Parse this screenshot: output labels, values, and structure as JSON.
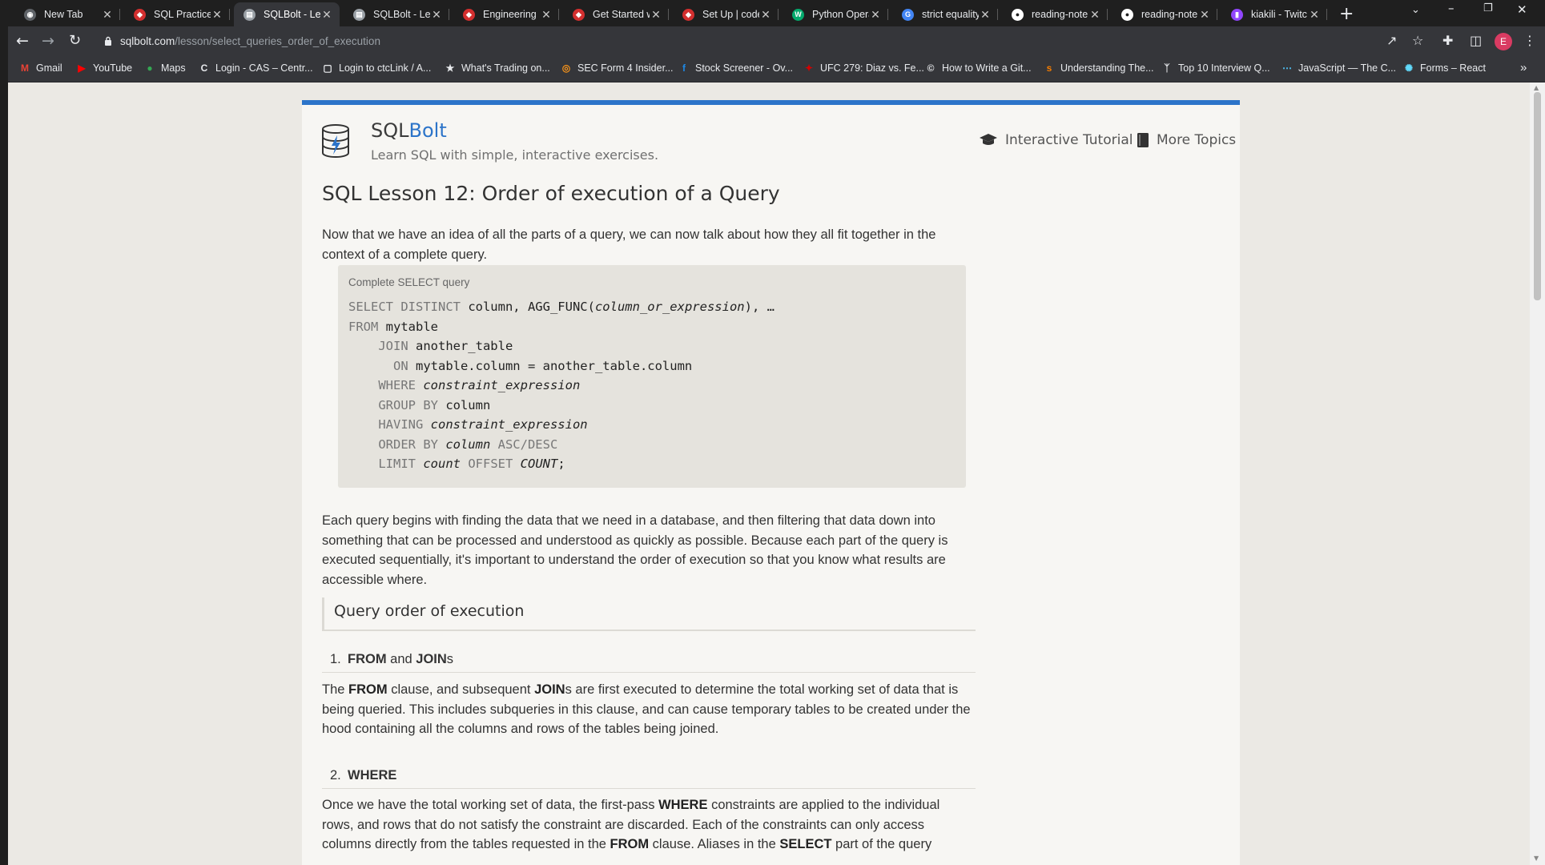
{
  "browser": {
    "tabs": [
      {
        "label": "New Tab",
        "icon": "chrome-icon",
        "color": "#5f6368",
        "active": false
      },
      {
        "label": "SQL Practice |",
        "icon": "shield-icon",
        "color": "#d32f2f",
        "active": false
      },
      {
        "label": "SQLBolt - Lea",
        "icon": "sqlbolt-icon",
        "color": "#9aa0a6",
        "active": true
      },
      {
        "label": "SQLBolt - Lea",
        "icon": "sqlbolt-icon",
        "color": "#9aa0a6",
        "active": false
      },
      {
        "label": "Engineering F",
        "icon": "shield-icon",
        "color": "#d32f2f",
        "active": false
      },
      {
        "label": "Get Started w",
        "icon": "shield-icon",
        "color": "#d32f2f",
        "active": false
      },
      {
        "label": "Set Up | code",
        "icon": "shield-icon",
        "color": "#d32f2f",
        "active": false
      },
      {
        "label": "Python Opera",
        "icon": "w3-icon",
        "color": "#04aa6d",
        "active": false
      },
      {
        "label": "strict equality",
        "icon": "google-icon",
        "color": "#4285f4",
        "active": false
      },
      {
        "label": "reading-note",
        "icon": "github-icon",
        "color": "#ffffff",
        "active": false
      },
      {
        "label": "reading-note",
        "icon": "github-icon",
        "color": "#ffffff",
        "active": false
      },
      {
        "label": "kiakili - Twitc",
        "icon": "twitch-icon",
        "color": "#9146ff",
        "active": false
      }
    ],
    "address": {
      "domain": "sqlbolt.com",
      "path": "/lesson/select_queries_order_of_execution"
    },
    "profile_initial": "E",
    "bookmarks": [
      {
        "label": "Gmail",
        "icon": "gmail-icon",
        "color": "#ea4335"
      },
      {
        "label": "YouTube",
        "icon": "youtube-icon",
        "color": "#ff0000"
      },
      {
        "label": "Maps",
        "icon": "maps-icon",
        "color": "#34a853"
      },
      {
        "label": "Login - CAS – Centr...",
        "icon": "cas-icon",
        "color": "#e8eaed"
      },
      {
        "label": "Login to ctcLink / A...",
        "icon": "ctclink-icon",
        "color": "#e8eaed"
      },
      {
        "label": "What's Trading on...",
        "icon": "star-icon",
        "color": "#e8eaed"
      },
      {
        "label": "SEC Form 4 Insider...",
        "icon": "sec-icon",
        "color": "#f7931a"
      },
      {
        "label": "Stock Screener - Ov...",
        "icon": "finviz-icon",
        "color": "#1e88e5"
      },
      {
        "label": "UFC 279: Diaz vs. Fe...",
        "icon": "ufc-icon",
        "color": "#d50000"
      },
      {
        "label": "How to Write a Git...",
        "icon": "copyright-icon",
        "color": "#e8eaed"
      },
      {
        "label": "Understanding The...",
        "icon": "sp-icon",
        "color": "#f57c00"
      },
      {
        "label": "Top 10 Interview Q...",
        "icon": "deer-icon",
        "color": "#e8eaed"
      },
      {
        "label": "JavaScript — The C...",
        "icon": "dots-icon",
        "color": "#4fc3f7"
      },
      {
        "label": "Forms – React",
        "icon": "react-icon",
        "color": "#61dafb"
      }
    ]
  },
  "site": {
    "brand_prefix": "SQL",
    "brand_suffix": "Bolt",
    "tagline": "Learn SQL with simple, interactive exercises.",
    "nav": {
      "tutorial": "Interactive Tutorial",
      "topics": "More Topics"
    },
    "accent": "#2c74c9"
  },
  "lesson": {
    "title": "SQL Lesson 12: Order of execution of a Query",
    "intro": "Now that we have an idea of all the parts of a query, we can now talk about how they all fit together in the context of a complete query.",
    "code_caption": "Complete SELECT query",
    "code": [
      {
        "kw": "SELECT DISTINCT",
        "text": " column, AGG_FUNC(",
        "it": "column_or_expression",
        "tail": "), …"
      },
      {
        "kw": "FROM",
        "text": " mytable"
      },
      {
        "kw": "    JOIN",
        "text": " another_table"
      },
      {
        "kw": "      ON",
        "text": " mytable.column = another_table.column"
      },
      {
        "kw": "    WHERE",
        "it": " constraint_expression"
      },
      {
        "kw": "    GROUP BY",
        "text": " column"
      },
      {
        "kw": "    HAVING",
        "it": " constraint_expression"
      },
      {
        "kw": "    ORDER BY",
        "it": " column",
        "kw2": " ASC/DESC"
      },
      {
        "kw": "    LIMIT",
        "it2": " count",
        "kw2": " OFFSET",
        "it3": " COUNT",
        "tail": ";"
      }
    ],
    "explanation": "Each query begins with finding the data that we need in a database, and then filtering that data down into something that can be processed and understood as quickly as possible. Because each part of the query is executed sequentially, it's important to understand the order of execution so that you know what results are accessible where.",
    "section_title": "Query order of execution",
    "steps": [
      {
        "num": "1.",
        "kw1": "FROM",
        "mid": " and ",
        "kw2": "JOIN",
        "tail": "s"
      },
      {
        "num": "2.",
        "kw1": "WHERE"
      }
    ],
    "step1_text": {
      "a": "The ",
      "b": "FROM",
      "c": " clause, and subsequent ",
      "d": "JOIN",
      "e": "s are first executed to determine the total working set of data that is being queried. This includes subqueries in this clause, and can cause temporary tables to be created under the hood containing all the columns and rows of the tables being joined."
    },
    "step2_text": {
      "a": "Once we have the total working set of data, the first-pass ",
      "b": "WHERE",
      "c": " constraints are applied to the individual rows, and rows that do not satisfy the constraint are discarded. Each of the constraints can only access columns directly from the tables requested in the ",
      "d": "FROM",
      "e": " clause. Aliases in the ",
      "f": "SELECT",
      "g": " part of the query"
    }
  }
}
